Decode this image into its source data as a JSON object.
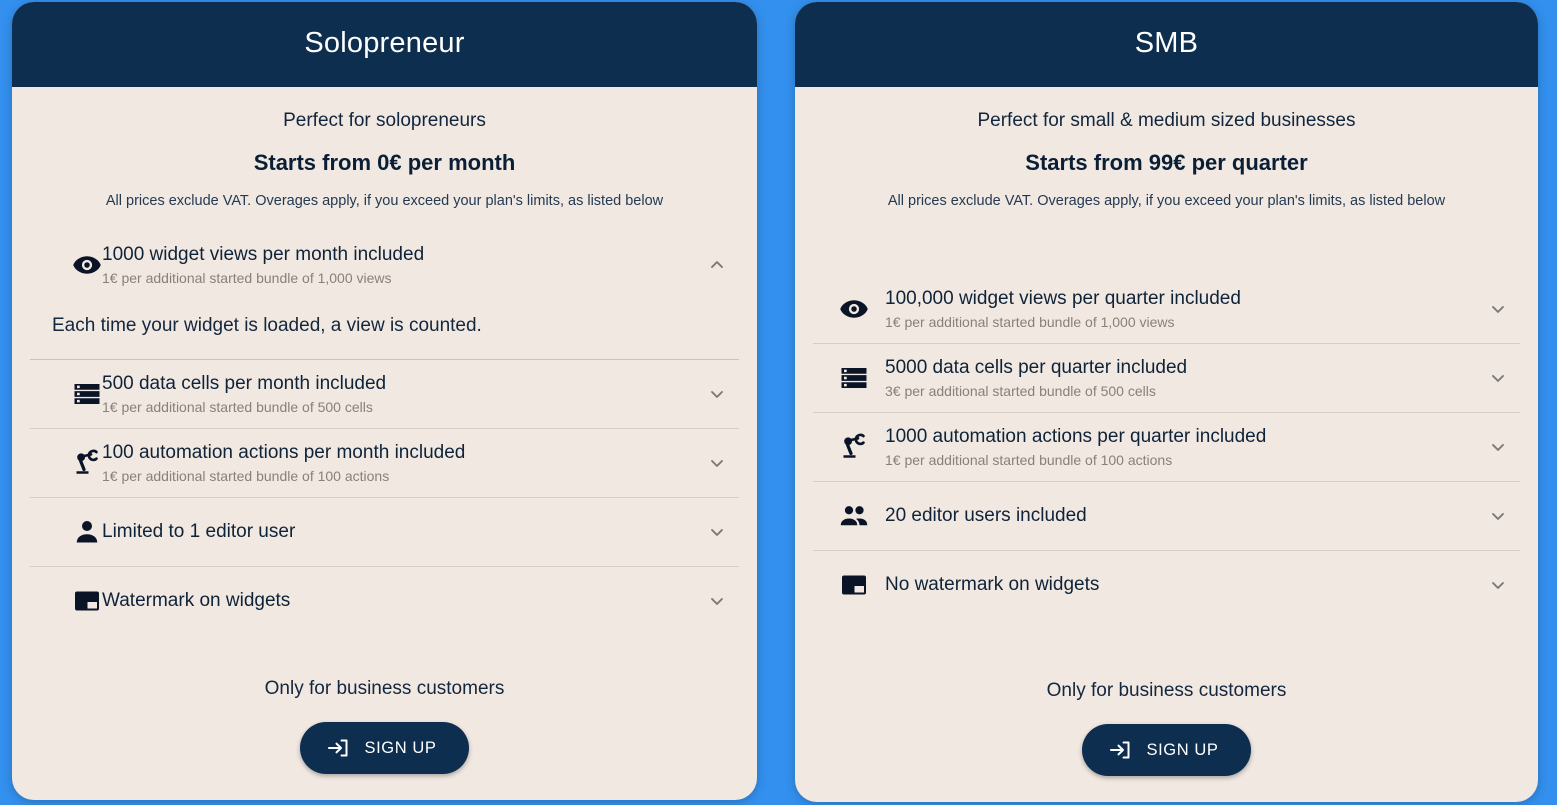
{
  "theme": {
    "page_background": "#3390ee",
    "card_background": "#f1e8e2",
    "header_background": "#0d2e4e",
    "header_text": "#ffffff",
    "body_text": "#0f2338",
    "muted_text": "#8a8078",
    "divider": "#d6cbc5",
    "button_background": "#0d2e4e",
    "button_text": "#ffffff"
  },
  "plans": [
    {
      "id": "solopreneur",
      "title": "Solopreneur",
      "tagline": "Perfect for solopreneurs",
      "price": "Starts from 0€ per month",
      "vat_note": "All prices exclude VAT. Overages apply, if you exceed your plan's limits, as listed below",
      "features": [
        {
          "icon": "eye-icon",
          "title": "1000 widget views per month included",
          "sub": "1€ per additional started bundle of 1,000 views",
          "expanded": true,
          "chevron": "chevron-up-icon",
          "detail": "Each time your widget is loaded, a view is counted."
        },
        {
          "icon": "data-cells-icon",
          "title": "500 data cells per month included",
          "sub": "1€ per additional started bundle of 500 cells",
          "expanded": false,
          "chevron": "chevron-down-icon",
          "detail": ""
        },
        {
          "icon": "robot-arm-icon",
          "title": "100 automation actions per month included",
          "sub": "1€ per additional started bundle of 100 actions",
          "expanded": false,
          "chevron": "chevron-down-icon",
          "detail": ""
        },
        {
          "icon": "person-icon",
          "title": "Limited to 1 editor user",
          "sub": "",
          "expanded": false,
          "chevron": "chevron-down-icon",
          "detail": ""
        },
        {
          "icon": "watermark-icon",
          "title": "Watermark on widgets",
          "sub": "",
          "expanded": false,
          "chevron": "chevron-down-icon",
          "detail": ""
        }
      ],
      "footer_note": "Only for business customers",
      "cta_label": "SIGN UP",
      "cta_icon": "sign-in-arrow-icon"
    },
    {
      "id": "smb",
      "title": "SMB",
      "tagline": "Perfect for small & medium sized businesses",
      "price": "Starts from 99€ per quarter",
      "vat_note": "All prices exclude VAT. Overages apply, if you exceed your plan's limits, as listed below",
      "features": [
        {
          "icon": "eye-icon",
          "title": "100,000 widget views per quarter included",
          "sub": "1€ per additional started bundle of 1,000 views",
          "expanded": false,
          "chevron": "chevron-down-icon",
          "detail": ""
        },
        {
          "icon": "data-cells-icon",
          "title": "5000 data cells per quarter included",
          "sub": "3€ per additional started bundle of 500 cells",
          "expanded": false,
          "chevron": "chevron-down-icon",
          "detail": ""
        },
        {
          "icon": "robot-arm-icon",
          "title": "1000 automation actions per quarter included",
          "sub": "1€ per additional started bundle of 100 actions",
          "expanded": false,
          "chevron": "chevron-down-icon",
          "detail": ""
        },
        {
          "icon": "people-icon",
          "title": "20 editor users included",
          "sub": "",
          "expanded": false,
          "chevron": "chevron-down-icon",
          "detail": ""
        },
        {
          "icon": "watermark-icon",
          "title": "No watermark on widgets",
          "sub": "",
          "expanded": false,
          "chevron": "chevron-down-icon",
          "detail": ""
        }
      ],
      "footer_note": "Only for business customers",
      "cta_label": "SIGN UP",
      "cta_icon": "sign-in-arrow-icon"
    }
  ]
}
